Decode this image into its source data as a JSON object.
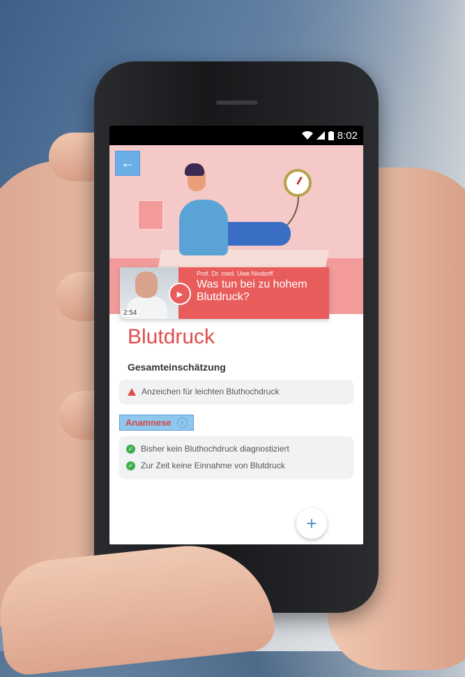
{
  "status_bar": {
    "time": "8:02"
  },
  "video": {
    "author": "Prof. Dr. med. Uwe Nixdorff",
    "title": "Was tun bei zu hohem Blutdruck?",
    "duration": "2:54"
  },
  "page": {
    "title": "Blutdruck"
  },
  "assessment": {
    "heading": "Gesamteinschätzung",
    "warning_text": "Anzeichen für leichten Bluthochdruck"
  },
  "anamnesis": {
    "label": "Anamnese",
    "items": [
      {
        "text": "Bisher kein Bluthochdruck diagnostiziert"
      },
      {
        "text": "Zur Zeit keine Einnahme von Blutdruck"
      }
    ]
  },
  "colors": {
    "accent_red": "#e14c4c",
    "video_red": "#e95c5c",
    "check_green": "#3fae50",
    "highlight_blue": "#6aaee8"
  }
}
